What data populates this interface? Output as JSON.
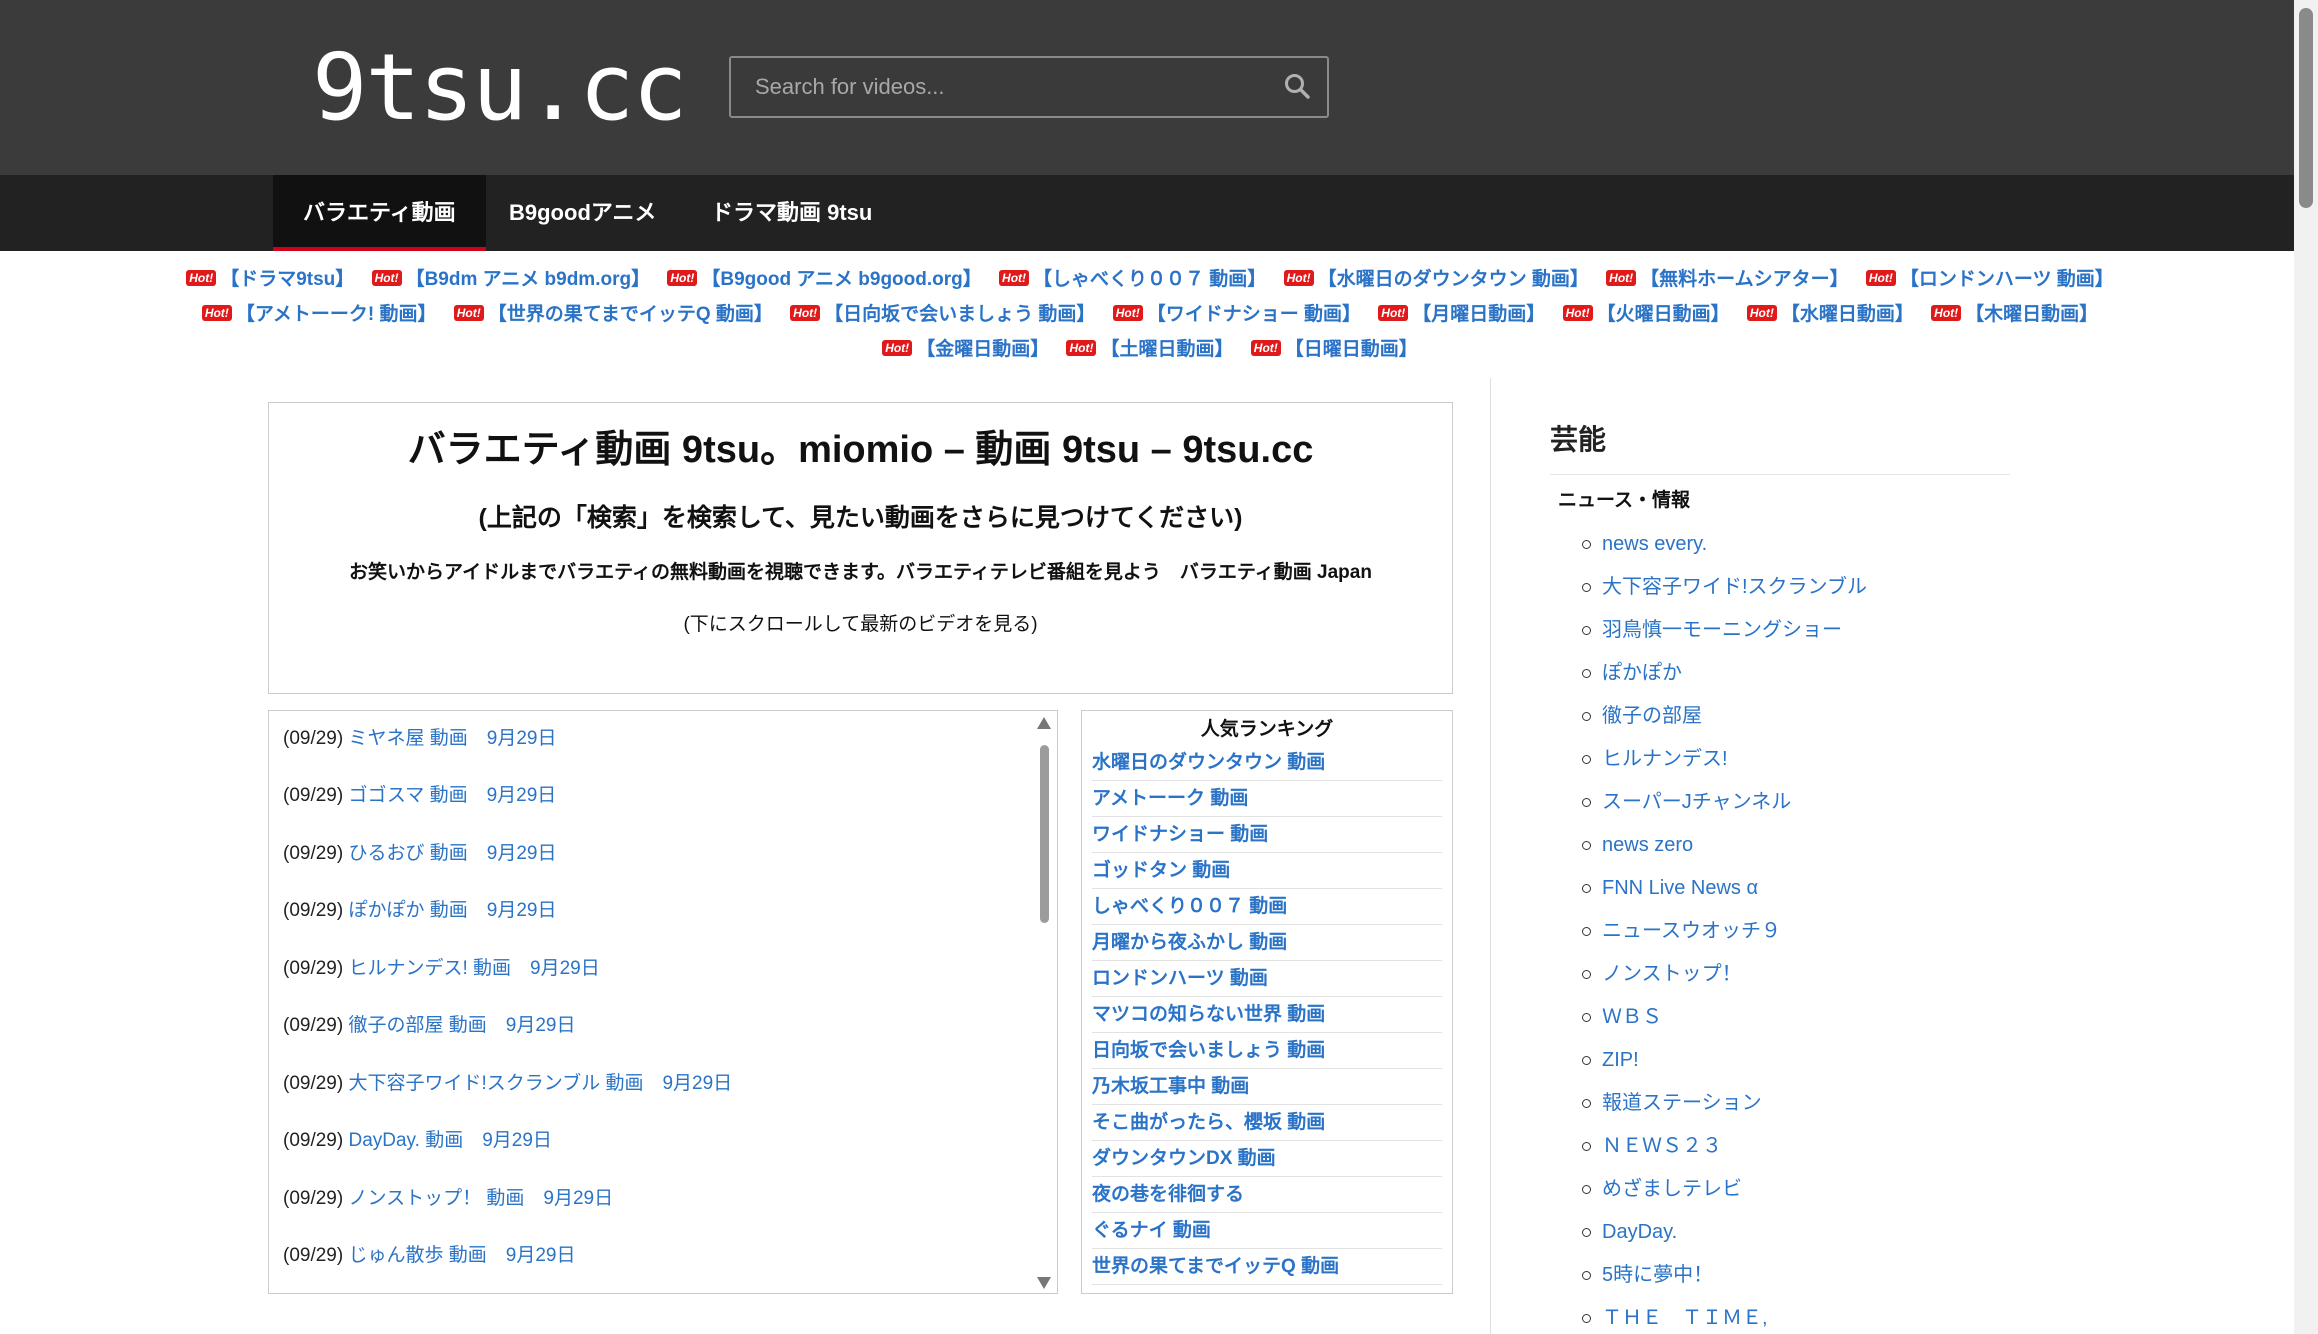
{
  "header": {
    "logo": "9tsu.cc",
    "search_placeholder": "Search for videos..."
  },
  "nav": [
    {
      "label": "バラエティ動画",
      "active": true
    },
    {
      "label": "B9goodアニメ",
      "active": false
    },
    {
      "label": "ドラマ動画 9tsu",
      "active": false
    }
  ],
  "hot_badge": "Hot!",
  "hotlinks": [
    "【ドラマ9tsu】",
    "【B9dm アニメ b9dm.org】",
    "【B9good アニメ b9good.org】",
    "【しゃべくり００７ 動画】",
    "【水曜日のダウンタウン 動画】",
    "【無料ホームシアター】",
    "【ロンドンハーツ 動画】",
    "【アメトーーク! 動画】",
    "【世界の果てまでイッテQ 動画】",
    "【日向坂で会いましょう 動画】",
    "【ワイドナショー 動画】",
    "【月曜日動画】",
    "【火曜日動画】",
    "【水曜日動画】",
    "【木曜日動画】",
    "【金曜日動画】",
    "【土曜日動画】",
    "【日曜日動画】"
  ],
  "main": {
    "title": "バラエティ動画 9tsu。miomio – 動画 9tsu – 9tsu.cc",
    "subtitle": "(上記の「検索」を検索して、見たい動画をさらに見つけてください)",
    "description": "お笑いからアイドルまでバラエティの無料動画を視聴できます。バラエティテレビ番組を見よう　バラエティ動画 Japan",
    "scroll_hint": "(下にスクロールして最新のビデオを見る)"
  },
  "latest_videos": [
    {
      "date": "(09/29)",
      "title": "ミヤネ屋 動画　9月29日"
    },
    {
      "date": "(09/29)",
      "title": "ゴゴスマ 動画　9月29日"
    },
    {
      "date": "(09/29)",
      "title": "ひるおび 動画　9月29日"
    },
    {
      "date": "(09/29)",
      "title": "ぽかぽか 動画　9月29日"
    },
    {
      "date": "(09/29)",
      "title": "ヒルナンデス! 動画　9月29日"
    },
    {
      "date": "(09/29)",
      "title": "徹子の部屋 動画　9月29日"
    },
    {
      "date": "(09/29)",
      "title": "大下容子ワイド!スクランブル 動画　9月29日"
    },
    {
      "date": "(09/29)",
      "title": "DayDay. 動画　9月29日"
    },
    {
      "date": "(09/29)",
      "title": "ノンストップ！ 動画　9月29日"
    },
    {
      "date": "(09/29)",
      "title": "じゅん散歩 動画　9月29日"
    }
  ],
  "ranking": {
    "title": "人気ランキング",
    "items": [
      "水曜日のダウンタウン 動画",
      "アメトーーク 動画",
      "ワイドナショー 動画",
      "ゴッドタン 動画",
      "しゃべくり００７ 動画",
      "月曜から夜ふかし 動画",
      "ロンドンハーツ 動画",
      "マツコの知らない世界 動画",
      "日向坂で会いましょう 動画",
      "乃木坂工事中 動画",
      "そこ曲がったら、櫻坂 動画",
      "ダウンタウンDX 動画",
      "夜の巷を徘徊する",
      "ぐるナイ 動画",
      "世界の果てまでイッテQ 動画"
    ]
  },
  "sidebar": {
    "heading": "芸能",
    "subheading": "ニュース・情報",
    "items": [
      "news every.",
      "大下容子ワイド!スクランブル",
      "羽鳥慎一モーニングショー",
      "ぽかぽか",
      "徹子の部屋",
      "ヒルナンデス!",
      "スーパーJチャンネル",
      "news zero",
      "FNN Live News α",
      "ニュースウオッチ９",
      "ノンストップ！",
      "ＷＢＳ",
      "ZIP!",
      "報道ステーション",
      "ＮＥＷＳ２３",
      "めざましテレビ",
      "DayDay.",
      "5時に夢中！",
      "ＴＨＥ　ＴＩＭＥ,"
    ]
  }
}
